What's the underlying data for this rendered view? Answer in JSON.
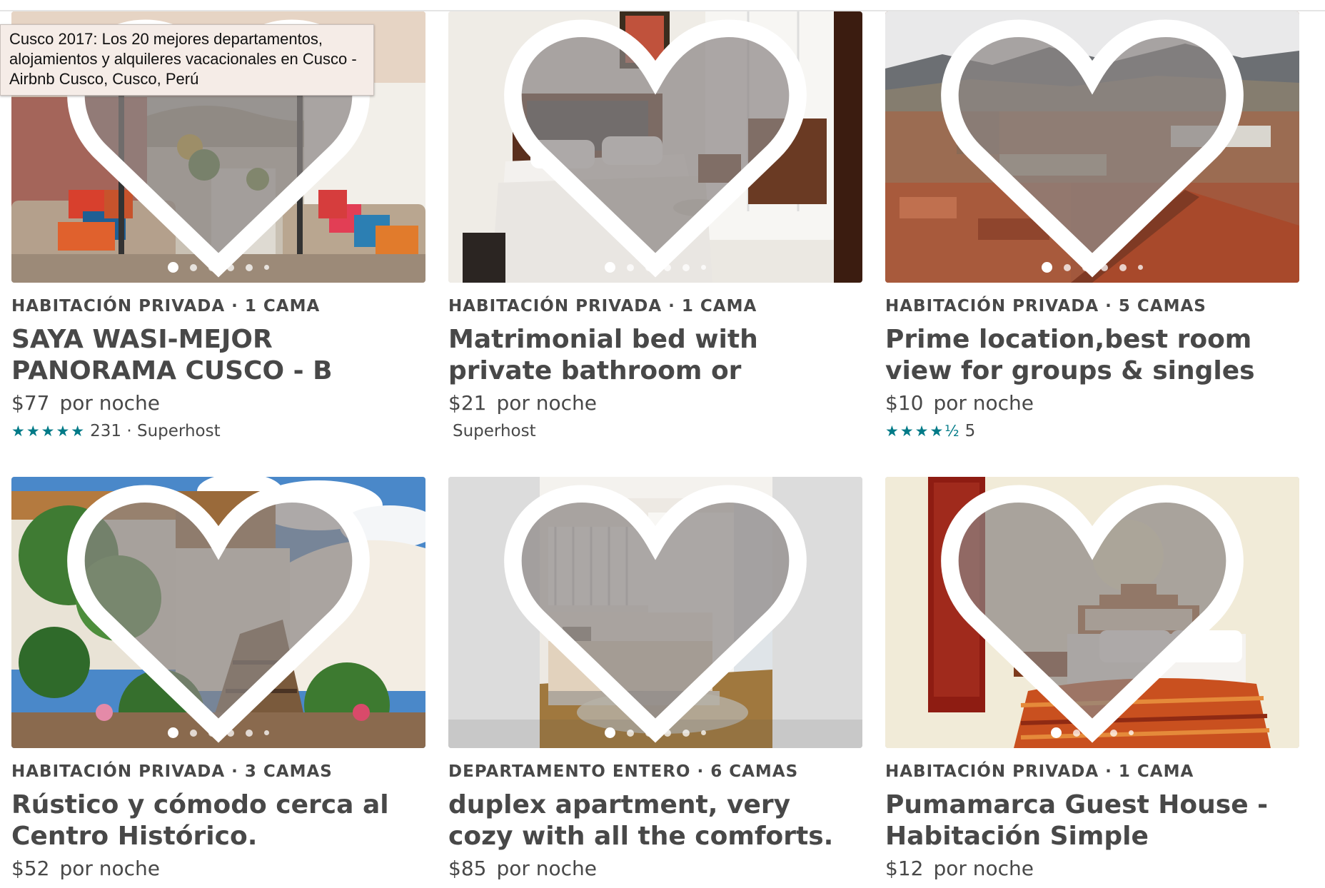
{
  "tooltip": "Cusco 2017: Los 20 mejores departamentos, alojamientos y alquileres vacacionales en Cusco - Airbnb Cusco, Cusco, Perú",
  "listings": [
    {
      "meta": "HABITACIÓN PRIVADA · 1 CAMA",
      "title": "SAYA WASI-MEJOR PANORAMA CUSCO - B",
      "price": "$77",
      "price_unit": "por noche",
      "stars": "★★★★★",
      "rating_text": "231 · Superhost",
      "photo": "rooftop-terrace",
      "dot_count": 6,
      "active_dot": 1
    },
    {
      "meta": "HABITACIÓN PRIVADA · 1 CAMA",
      "title": "Matrimonial bed with private bathroom or singlebed",
      "price": "$21",
      "price_unit": "por noche",
      "stars": "",
      "rating_text": "Superhost",
      "photo": "bedroom-white",
      "dot_count": 6,
      "active_dot": 1
    },
    {
      "meta": "HABITACIÓN PRIVADA · 5 CAMAS",
      "title": "Prime location,best room view for groups & singles",
      "price": "$10",
      "price_unit": "por noche",
      "stars": "★★★★½",
      "rating_text": "5",
      "photo": "city-rooftops",
      "dot_count": 6,
      "active_dot": 1
    },
    {
      "meta": "HABITACIÓN PRIVADA · 3 CAMAS",
      "title": "Rústico y cómodo cerca al Centro Histórico.",
      "price": "$52",
      "price_unit": "por noche",
      "stars": "",
      "rating_text": "",
      "photo": "rustic-courtyard",
      "dot_count": 6,
      "active_dot": 1
    },
    {
      "meta": "DEPARTAMENTO ENTERO · 6 CAMAS",
      "title": "duplex apartment, very cozy with all the comforts.",
      "price": "$85",
      "price_unit": "por noche",
      "stars": "",
      "rating_text": "",
      "photo": "apartment-bedroom",
      "dot_count": 6,
      "active_dot": 1
    },
    {
      "meta": "HABITACIÓN PRIVADA · 1 CAMA",
      "title": "Pumamarca Guest House - Habitación Simple",
      "price": "$12",
      "price_unit": "por noche",
      "stars": "",
      "rating_text": "",
      "photo": "guest-house-bedroom",
      "dot_count": 5,
      "active_dot": 1
    }
  ],
  "colors": {
    "text": "#484848",
    "star": "#007a87",
    "heart_fill": "#8a8483"
  }
}
